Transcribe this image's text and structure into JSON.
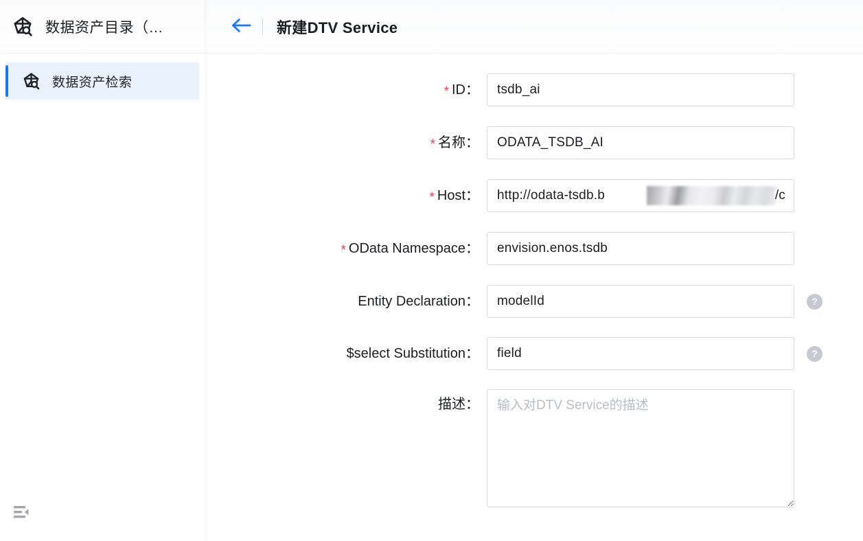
{
  "sidebar": {
    "brand": {
      "logo_icon": "asset-catalog-logo-icon",
      "title": "数据资产目录（…"
    },
    "nav_items": [
      {
        "icon": "asset-search-icon",
        "label": "数据资产检索",
        "active": true
      }
    ],
    "collapse_icon": "menu-fold-icon"
  },
  "header": {
    "back_icon": "arrow-left-icon",
    "title": "新建DTV Service"
  },
  "form": {
    "fields": [
      {
        "key": "id",
        "label": "ID：",
        "required": true,
        "value": "tsdb_ai",
        "placeholder": "",
        "help": false
      },
      {
        "key": "name",
        "label": "名称：",
        "required": true,
        "value": "ODATA_TSDB_AI",
        "placeholder": "",
        "help": false
      },
      {
        "key": "host",
        "label": "Host：",
        "required": true,
        "value": "http://odata-tsdb.b",
        "value_suffix": "/c",
        "redacted": true,
        "placeholder": "",
        "help": false
      },
      {
        "key": "odata_namespace",
        "label": "OData Namespace：",
        "required": true,
        "value": "envision.enos.tsdb",
        "placeholder": "",
        "help": false
      },
      {
        "key": "entity_declaration",
        "label": "Entity Declaration：",
        "required": false,
        "value": "modelId",
        "placeholder": "",
        "help": true,
        "help_icon": "question-circle-icon"
      },
      {
        "key": "select_substitution",
        "label": "$select Substitution：",
        "required": false,
        "value": "field",
        "placeholder": "",
        "help": true,
        "help_icon": "question-circle-icon"
      }
    ],
    "description": {
      "key": "description",
      "label": "描述：",
      "required": false,
      "value": "",
      "placeholder": "输入对DTV Service的描述"
    },
    "required_marker": "*"
  },
  "colors": {
    "accent_blue": "#1677ff",
    "required_red": "#f5414f",
    "active_nav_bg": "#e9f1fd",
    "border_grey": "#d8dade",
    "help_icon_grey": "#c6c8d2",
    "text_primary": "#1b1d21",
    "placeholder_grey": "#bcc0c7"
  }
}
